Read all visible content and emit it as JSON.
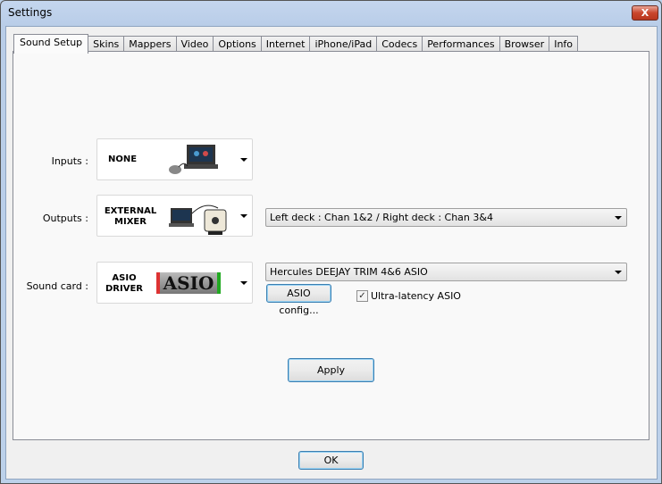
{
  "window": {
    "title": "Settings",
    "close_label": "X"
  },
  "tabs": [
    "Sound Setup",
    "Skins",
    "Mappers",
    "Video",
    "Options",
    "Internet",
    "iPhone/iPad",
    "Codecs",
    "Performances",
    "Browser",
    "Info"
  ],
  "sound_setup": {
    "inputs": {
      "label": "Inputs :",
      "value": "NONE"
    },
    "outputs": {
      "label": "Outputs :",
      "value_line1": "EXTERNAL",
      "value_line2": "MIXER",
      "routing": "Left deck : Chan 1&2 / Right deck : Chan 3&4"
    },
    "sound_card": {
      "label": "Sound card :",
      "value_line1": "ASIO",
      "value_line2": "DRIVER",
      "logo": "ASIO",
      "device": "Hercules DEEJAY TRIM 4&6 ASIO",
      "config_button": "ASIO config...",
      "ultra_latency_label": "Ultra-latency ASIO",
      "ultra_latency_checked": true
    },
    "apply_button": "Apply"
  },
  "ok_button": "OK"
}
